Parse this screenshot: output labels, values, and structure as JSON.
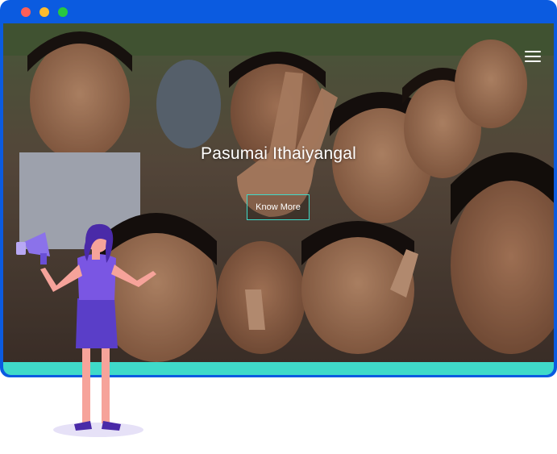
{
  "window": {
    "controls": [
      "close",
      "minimize",
      "maximize"
    ]
  },
  "hero": {
    "title": "Pasumai Ithaiyangal",
    "button_label": "Know More",
    "background_image": "photo of smiling schoolchildren making V-sign gestures"
  },
  "nav": {
    "menu_icon": "hamburger-menu-icon"
  },
  "colors": {
    "frame": "#0b5be0",
    "accent_teal": "#3fdac9",
    "character_top": "#7a56e3",
    "character_skirt": "#5a3ec8",
    "character_hair": "#4a2aa8",
    "character_skin": "#f6a39a"
  }
}
